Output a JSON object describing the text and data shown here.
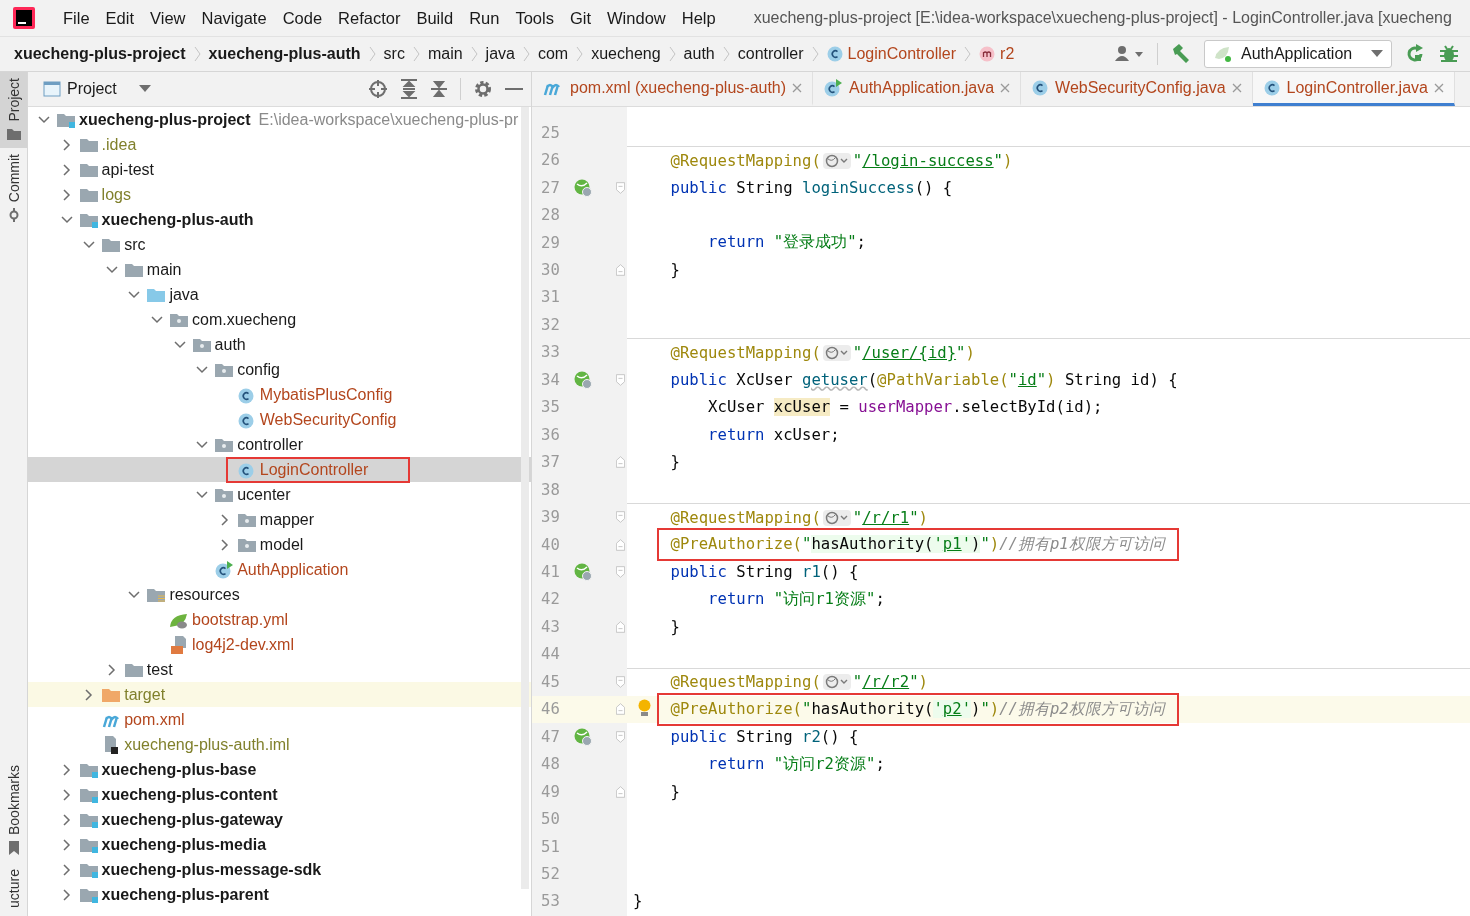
{
  "window": {
    "title": "xuecheng-plus-project [E:\\idea-workspace\\xuecheng-plus-project] - LoginController.java [xuecheng"
  },
  "menu": [
    "File",
    "Edit",
    "View",
    "Navigate",
    "Code",
    "Refactor",
    "Build",
    "Run",
    "Tools",
    "Git",
    "Window",
    "Help"
  ],
  "breadcrumb": [
    {
      "label": "xuecheng-plus-project",
      "kind": "module"
    },
    {
      "label": "xuecheng-plus-auth",
      "kind": "module"
    },
    {
      "label": "src",
      "kind": "folder"
    },
    {
      "label": "main",
      "kind": "folder"
    },
    {
      "label": "java",
      "kind": "folder"
    },
    {
      "label": "com",
      "kind": "folder"
    },
    {
      "label": "xuecheng",
      "kind": "folder"
    },
    {
      "label": "auth",
      "kind": "folder"
    },
    {
      "label": "controller",
      "kind": "folder"
    },
    {
      "label": "LoginController",
      "kind": "class"
    },
    {
      "label": "r2",
      "kind": "method"
    }
  ],
  "run_config": {
    "label": "AuthApplication"
  },
  "side_stripe": {
    "top": [
      {
        "label": "Project",
        "kind": "project",
        "selected": true
      },
      {
        "label": "Commit",
        "kind": "commit",
        "selected": false
      }
    ],
    "bottom": [
      {
        "label": "Bookmarks",
        "kind": "bookmarks",
        "selected": false
      },
      {
        "label": "ucture",
        "kind": "structure",
        "selected": false
      }
    ]
  },
  "project_panel": {
    "title": "Project",
    "tree": [
      {
        "label": "xuecheng-plus-project",
        "hint": "E:\\idea-workspace\\xuecheng-plus-pr",
        "kind": "module",
        "selected": false,
        "expanded": true,
        "children": [
          {
            "label": ".idea",
            "kind": "folder-ignored",
            "selected": false,
            "expanded": false
          },
          {
            "label": "api-test",
            "kind": "folder",
            "selected": false,
            "expanded": false
          },
          {
            "label": "logs",
            "kind": "folder-ignored",
            "selected": false,
            "expanded": false
          },
          {
            "label": "xuecheng-plus-auth",
            "kind": "module",
            "selected": false,
            "expanded": true,
            "children": [
              {
                "label": "src",
                "kind": "folder",
                "selected": false,
                "expanded": true,
                "children": [
                  {
                    "label": "main",
                    "kind": "folder",
                    "selected": false,
                    "expanded": true,
                    "children": [
                      {
                        "label": "java",
                        "kind": "source-root",
                        "selected": false,
                        "expanded": true,
                        "children": [
                          {
                            "label": "com.xuecheng",
                            "kind": "package",
                            "selected": false,
                            "expanded": true,
                            "children": [
                              {
                                "label": "auth",
                                "kind": "package",
                                "selected": false,
                                "expanded": true,
                                "children": [
                                  {
                                    "label": "config",
                                    "kind": "package",
                                    "selected": false,
                                    "expanded": true,
                                    "children": [
                                      {
                                        "label": "MybatisPlusConfig",
                                        "kind": "class",
                                        "selected": false
                                      },
                                      {
                                        "label": "WebSecurityConfig",
                                        "kind": "class",
                                        "selected": false
                                      }
                                    ]
                                  },
                                  {
                                    "label": "controller",
                                    "kind": "package",
                                    "selected": false,
                                    "expanded": true,
                                    "children": [
                                      {
                                        "label": "LoginController",
                                        "kind": "class",
                                        "selected": true,
                                        "marked": true
                                      }
                                    ]
                                  },
                                  {
                                    "label": "ucenter",
                                    "kind": "package",
                                    "selected": false,
                                    "expanded": true,
                                    "children": [
                                      {
                                        "label": "mapper",
                                        "kind": "package",
                                        "selected": false,
                                        "expanded": false
                                      },
                                      {
                                        "label": "model",
                                        "kind": "package",
                                        "selected": false,
                                        "expanded": false
                                      }
                                    ]
                                  },
                                  {
                                    "label": "AuthApplication",
                                    "kind": "app",
                                    "selected": false
                                  }
                                ]
                              }
                            ]
                          }
                        ]
                      },
                      {
                        "label": "resources",
                        "kind": "resources",
                        "selected": false,
                        "expanded": true,
                        "children": [
                          {
                            "label": "bootstrap.yml",
                            "kind": "yml",
                            "selected": false
                          },
                          {
                            "label": "log4j2-dev.xml",
                            "kind": "xml",
                            "selected": false
                          }
                        ]
                      }
                    ]
                  },
                  {
                    "label": "test",
                    "kind": "folder",
                    "selected": false,
                    "expanded": false
                  }
                ]
              },
              {
                "label": "target",
                "kind": "excluded",
                "selected": false,
                "expanded": false
              },
              {
                "label": "pom.xml",
                "kind": "maven",
                "selected": false
              },
              {
                "label": "xuecheng-plus-auth.iml",
                "kind": "iml",
                "selected": false
              }
            ]
          },
          {
            "label": "xuecheng-plus-base",
            "kind": "module",
            "selected": false,
            "expanded": false
          },
          {
            "label": "xuecheng-plus-content",
            "kind": "module",
            "selected": false,
            "expanded": false
          },
          {
            "label": "xuecheng-plus-gateway",
            "kind": "module",
            "selected": false,
            "expanded": false
          },
          {
            "label": "xuecheng-plus-media",
            "kind": "module",
            "selected": false,
            "expanded": false
          },
          {
            "label": "xuecheng-plus-message-sdk",
            "kind": "module",
            "selected": false,
            "expanded": false
          },
          {
            "label": "xuecheng-plus-parent",
            "kind": "module",
            "selected": false,
            "expanded": false
          }
        ]
      }
    ]
  },
  "editor": {
    "tabs": [
      {
        "label": "pom.xml (xuecheng-plus-auth)",
        "kind": "maven",
        "selected": false
      },
      {
        "label": "AuthApplication.java",
        "kind": "app",
        "selected": false
      },
      {
        "label": "WebSecurityConfig.java",
        "kind": "class",
        "selected": false
      },
      {
        "label": "LoginController.java",
        "kind": "class",
        "selected": true
      }
    ],
    "lines": [
      {
        "num": "25"
      },
      {
        "num": "26",
        "separator": true,
        "tokens": [
          {
            "kind": "ann",
            "t": "    @RequestMapping("
          },
          {
            "kind": "globe"
          },
          {
            "kind": "str",
            "t": "\""
          },
          {
            "kind": "url",
            "t": "/login-success"
          },
          {
            "kind": "str",
            "t": "\""
          },
          {
            "kind": "ann",
            "t": ")"
          }
        ]
      },
      {
        "num": "27",
        "endpoint": true,
        "fold_start": true,
        "tokens": [
          {
            "kind": "kw",
            "t": "    public "
          },
          {
            "kind": "plain",
            "t": "String "
          },
          {
            "kind": "decl",
            "t": "loginSuccess"
          },
          {
            "kind": "plain",
            "t": "() {"
          }
        ]
      },
      {
        "num": "28"
      },
      {
        "num": "29",
        "tokens": [
          {
            "kind": "kw",
            "t": "        return "
          },
          {
            "kind": "str",
            "t": "\"登录成功\""
          },
          {
            "kind": "plain",
            "t": ";"
          }
        ]
      },
      {
        "num": "30",
        "fold_end": true,
        "tokens": [
          {
            "kind": "plain",
            "t": "    }"
          }
        ]
      },
      {
        "num": "31"
      },
      {
        "num": "32"
      },
      {
        "num": "33",
        "separator": true,
        "tokens": [
          {
            "kind": "ann",
            "t": "    @RequestMapping("
          },
          {
            "kind": "globe"
          },
          {
            "kind": "str",
            "t": "\""
          },
          {
            "kind": "url",
            "t": "/user/{id}"
          },
          {
            "kind": "str",
            "t": "\""
          },
          {
            "kind": "ann",
            "t": ")"
          }
        ]
      },
      {
        "num": "34",
        "endpoint": true,
        "fold_start": true,
        "tokens": [
          {
            "kind": "kw",
            "t": "    public "
          },
          {
            "kind": "plain",
            "t": "XcUser "
          },
          {
            "kind": "warn",
            "t": "getuser"
          },
          {
            "kind": "plain",
            "t": "("
          },
          {
            "kind": "ann",
            "t": "@PathVariable("
          },
          {
            "kind": "str",
            "t": "\""
          },
          {
            "kind": "url",
            "t": "id"
          },
          {
            "kind": "str",
            "t": "\""
          },
          {
            "kind": "ann",
            "t": ")"
          },
          {
            "kind": "plain",
            "t": " String id) {"
          }
        ]
      },
      {
        "num": "35",
        "tokens": [
          {
            "kind": "plain",
            "t": "        XcUser "
          },
          {
            "kind": "hl",
            "t": "xcUser"
          },
          {
            "kind": "plain",
            "t": " = "
          },
          {
            "kind": "field",
            "t": "userMapper"
          },
          {
            "kind": "plain",
            "t": ".selectById(id);"
          }
        ]
      },
      {
        "num": "36",
        "tokens": [
          {
            "kind": "kw",
            "t": "        return "
          },
          {
            "kind": "plain",
            "t": "xcUser;"
          }
        ]
      },
      {
        "num": "37",
        "fold_end": true,
        "tokens": [
          {
            "kind": "plain",
            "t": "    }"
          }
        ]
      },
      {
        "num": "38"
      },
      {
        "num": "39",
        "separator": true,
        "fold_start": true,
        "tokens": [
          {
            "kind": "ann",
            "t": "    @RequestMapping("
          },
          {
            "kind": "globe"
          },
          {
            "kind": "str",
            "t": "\""
          },
          {
            "kind": "url",
            "t": "/r/r1"
          },
          {
            "kind": "str",
            "t": "\""
          },
          {
            "kind": "ann",
            "t": ")"
          }
        ]
      },
      {
        "num": "40",
        "fold_end": true,
        "marked": true,
        "tokens": [
          {
            "kind": "ann",
            "t": "    @PreAuthorize("
          },
          {
            "kind": "str",
            "t": "\""
          },
          {
            "kind": "spel",
            "t": "hasAuthority("
          },
          {
            "kind": "spelstr",
            "t": "'"
          },
          {
            "kind": "spelurl",
            "t": "p1"
          },
          {
            "kind": "spelstr",
            "t": "'"
          },
          {
            "kind": "spel",
            "t": ")"
          },
          {
            "kind": "str",
            "t": "\""
          },
          {
            "kind": "ann",
            "t": ")"
          },
          {
            "kind": "comment",
            "t": "//拥有p1权限方可访问"
          }
        ]
      },
      {
        "num": "41",
        "endpoint": true,
        "fold_start": true,
        "tokens": [
          {
            "kind": "kw",
            "t": "    public "
          },
          {
            "kind": "plain",
            "t": "String "
          },
          {
            "kind": "decl",
            "t": "r1"
          },
          {
            "kind": "plain",
            "t": "() {"
          }
        ]
      },
      {
        "num": "42",
        "tokens": [
          {
            "kind": "kw",
            "t": "        return "
          },
          {
            "kind": "str",
            "t": "\"访问r1资源\""
          },
          {
            "kind": "plain",
            "t": ";"
          }
        ]
      },
      {
        "num": "43",
        "fold_end": true,
        "tokens": [
          {
            "kind": "plain",
            "t": "    }"
          }
        ]
      },
      {
        "num": "44"
      },
      {
        "num": "45",
        "separator": true,
        "fold_start": true,
        "tokens": [
          {
            "kind": "ann",
            "t": "    @RequestMapping("
          },
          {
            "kind": "globe"
          },
          {
            "kind": "str",
            "t": "\""
          },
          {
            "kind": "url",
            "t": "/r/r2"
          },
          {
            "kind": "str",
            "t": "\""
          },
          {
            "kind": "ann",
            "t": ")"
          }
        ]
      },
      {
        "num": "46",
        "fold_end": true,
        "current": true,
        "bulb": true,
        "marked": true,
        "tokens": [
          {
            "kind": "ann",
            "t": "    @PreAuthorize("
          },
          {
            "kind": "str",
            "t": "\""
          },
          {
            "kind": "plain",
            "t": "hasAuthority("
          },
          {
            "kind": "spelstr",
            "t": "'"
          },
          {
            "kind": "spelurl",
            "t": "p2"
          },
          {
            "kind": "spelstr",
            "t": "'"
          },
          {
            "kind": "plain",
            "t": ")"
          },
          {
            "kind": "str",
            "t": "\""
          },
          {
            "kind": "ann",
            "t": ")"
          },
          {
            "kind": "comment",
            "t": "//拥有p2权限方可访问"
          }
        ]
      },
      {
        "num": "47",
        "endpoint": true,
        "fold_start": true,
        "tokens": [
          {
            "kind": "kw",
            "t": "    public "
          },
          {
            "kind": "plain",
            "t": "String "
          },
          {
            "kind": "decl",
            "t": "r2"
          },
          {
            "kind": "plain",
            "t": "() {"
          }
        ]
      },
      {
        "num": "48",
        "tokens": [
          {
            "kind": "kw",
            "t": "        return "
          },
          {
            "kind": "str",
            "t": "\"访问r2资源\""
          },
          {
            "kind": "plain",
            "t": ";"
          }
        ]
      },
      {
        "num": "49",
        "fold_end": true,
        "tokens": [
          {
            "kind": "plain",
            "t": "    }"
          }
        ]
      },
      {
        "num": "50"
      },
      {
        "num": "51"
      },
      {
        "num": "52"
      },
      {
        "num": "53",
        "tokens": [
          {
            "kind": "plain",
            "t": "}"
          }
        ]
      }
    ]
  }
}
